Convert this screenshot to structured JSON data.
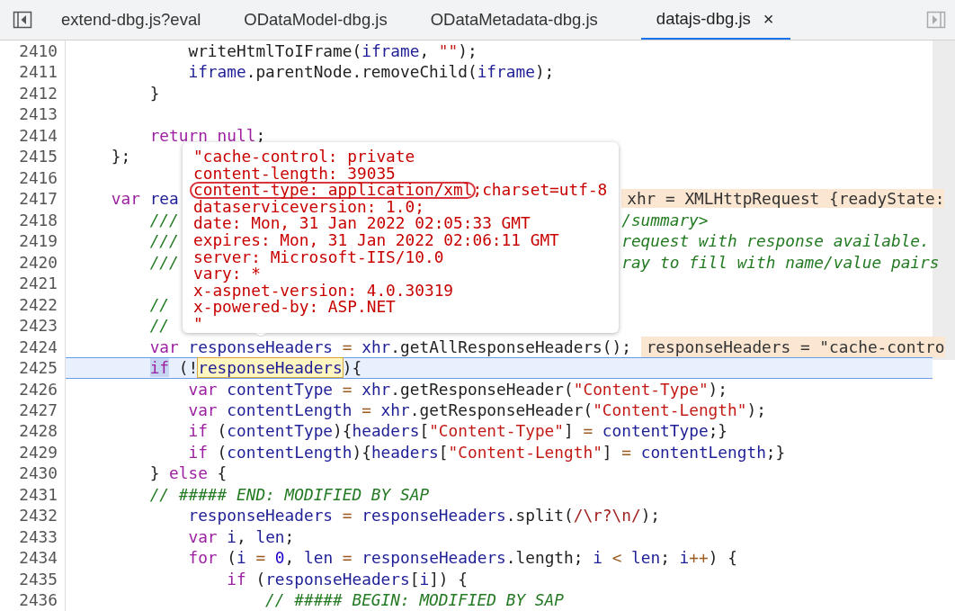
{
  "tabs": [
    {
      "label": "extend-dbg.js?eval",
      "selected": false
    },
    {
      "label": "ODataModel-dbg.js",
      "selected": false
    },
    {
      "label": "ODataMetadata-dbg.js",
      "selected": false
    },
    {
      "label": "datajs-dbg.js",
      "selected": true,
      "close": "×"
    }
  ],
  "lines": [
    {
      "number": "2410",
      "selected": false,
      "tokens": [
        {
          "kind": "plain",
          "text": "            writeHtmlToIFrame("
        },
        {
          "kind": "var",
          "text": "iframe"
        },
        {
          "kind": "plain",
          "text": ", "
        },
        {
          "kind": "str",
          "text": "\"\""
        },
        {
          "kind": "plain",
          "text": ");"
        }
      ]
    },
    {
      "number": "2411",
      "selected": false,
      "tokens": [
        {
          "kind": "var",
          "text": "            iframe"
        },
        {
          "kind": "plain",
          "text": ".parentNode.removeChild("
        },
        {
          "kind": "var",
          "text": "iframe"
        },
        {
          "kind": "plain",
          "text": ");"
        }
      ]
    },
    {
      "number": "2412",
      "selected": false,
      "tokens": [
        {
          "kind": "plain",
          "text": "        }"
        }
      ]
    },
    {
      "number": "2413",
      "selected": false
    },
    {
      "number": "2414",
      "selected": false,
      "tokens": [
        {
          "kind": "kw",
          "text": "        return null"
        },
        {
          "kind": "plain",
          "text": ";"
        }
      ]
    },
    {
      "number": "2415",
      "selected": false,
      "tokens": [
        {
          "kind": "plain",
          "text": "    };"
        }
      ]
    },
    {
      "number": "2416",
      "selected": false
    },
    {
      "number": "2417",
      "selected": false,
      "tokens": [
        {
          "kind": "kw",
          "text": "    var"
        },
        {
          "kind": "var",
          "text": " rea"
        }
      ],
      "aside": [
        {
          "kind": "value",
          "text": "xhr = XMLHttpRequest {readyState:"
        }
      ]
    },
    {
      "number": "2418",
      "selected": false,
      "tokens": [
        {
          "kind": "comment",
          "text": "        ///"
        }
      ],
      "aside": [
        {
          "kind": "comment",
          "text": "/summary>"
        }
      ]
    },
    {
      "number": "2419",
      "selected": false,
      "tokens": [
        {
          "kind": "comment",
          "text": "        ///"
        }
      ],
      "aside": [
        {
          "kind": "comment",
          "text": "request with response available."
        }
      ]
    },
    {
      "number": "2420",
      "selected": false,
      "tokens": [
        {
          "kind": "comment",
          "text": "        ///"
        }
      ],
      "aside": [
        {
          "kind": "comment",
          "text": "ray to fill with name/value pairs"
        }
      ]
    },
    {
      "number": "2421",
      "selected": false
    },
    {
      "number": "2422",
      "selected": false,
      "tokens": [
        {
          "kind": "comment",
          "text": "        //"
        }
      ]
    },
    {
      "number": "2423",
      "selected": false,
      "tokens": [
        {
          "kind": "comment",
          "text": "        //"
        }
      ]
    },
    {
      "number": "2424",
      "selected": false,
      "tokens": [
        {
          "kind": "kw",
          "text": "        var"
        },
        {
          "kind": "var",
          "text": " responseHeaders"
        },
        {
          "kind": "op",
          "text": " = "
        },
        {
          "kind": "var",
          "text": "xhr"
        },
        {
          "kind": "plain",
          "text": ".getAllResponseHeaders();"
        },
        {
          "kind": "value",
          "text": "responseHeaders = \"cache-contro"
        }
      ]
    },
    {
      "number": "2425",
      "selected": true,
      "tokens": [
        {
          "kind": "selection",
          "text": "        if"
        },
        {
          "kind": "plain",
          "text": " (!"
        },
        {
          "kind": "hover",
          "text": "responseHeaders"
        },
        {
          "kind": "plain",
          "text": "){"
        }
      ]
    },
    {
      "number": "2426",
      "selected": false,
      "tokens": [
        {
          "kind": "kw",
          "text": "            var"
        },
        {
          "kind": "var",
          "text": " contentType"
        },
        {
          "kind": "op",
          "text": " = "
        },
        {
          "kind": "var",
          "text": "xhr"
        },
        {
          "kind": "plain",
          "text": ".getResponseHeader("
        },
        {
          "kind": "str",
          "text": "\"Content-Type\""
        },
        {
          "kind": "plain",
          "text": ");"
        }
      ]
    },
    {
      "number": "2427",
      "selected": false,
      "tokens": [
        {
          "kind": "kw",
          "text": "            var"
        },
        {
          "kind": "var",
          "text": " contentLength"
        },
        {
          "kind": "op",
          "text": " = "
        },
        {
          "kind": "var",
          "text": "xhr"
        },
        {
          "kind": "plain",
          "text": ".getResponseHeader("
        },
        {
          "kind": "str",
          "text": "\"Content-Length\""
        },
        {
          "kind": "plain",
          "text": ");"
        }
      ]
    },
    {
      "number": "2428",
      "selected": false,
      "tokens": [
        {
          "kind": "kw",
          "text": "            if"
        },
        {
          "kind": "plain",
          "text": " ("
        },
        {
          "kind": "var",
          "text": "contentType"
        },
        {
          "kind": "plain",
          "text": "){"
        },
        {
          "kind": "var",
          "text": "headers"
        },
        {
          "kind": "plain",
          "text": "["
        },
        {
          "kind": "str",
          "text": "\"Content-Type\""
        },
        {
          "kind": "plain",
          "text": "]"
        },
        {
          "kind": "op",
          "text": " = "
        },
        {
          "kind": "var",
          "text": "contentType"
        },
        {
          "kind": "plain",
          "text": ";}"
        }
      ]
    },
    {
      "number": "2429",
      "selected": false,
      "tokens": [
        {
          "kind": "kw",
          "text": "            if"
        },
        {
          "kind": "plain",
          "text": " ("
        },
        {
          "kind": "var",
          "text": "contentLength"
        },
        {
          "kind": "plain",
          "text": "){"
        },
        {
          "kind": "var",
          "text": "headers"
        },
        {
          "kind": "plain",
          "text": "["
        },
        {
          "kind": "str",
          "text": "\"Content-Length\""
        },
        {
          "kind": "plain",
          "text": "]"
        },
        {
          "kind": "op",
          "text": " = "
        },
        {
          "kind": "var",
          "text": "contentLength"
        },
        {
          "kind": "plain",
          "text": ";}"
        }
      ]
    },
    {
      "number": "2430",
      "selected": false,
      "tokens": [
        {
          "kind": "plain",
          "text": "        } "
        },
        {
          "kind": "kw",
          "text": "else"
        },
        {
          "kind": "plain",
          "text": " {"
        }
      ]
    },
    {
      "number": "2431",
      "selected": false,
      "tokens": [
        {
          "kind": "comment",
          "text": "        // ##### END: MODIFIED BY SAP"
        }
      ]
    },
    {
      "number": "2432",
      "selected": false,
      "tokens": [
        {
          "kind": "var",
          "text": "            responseHeaders"
        },
        {
          "kind": "op",
          "text": " = "
        },
        {
          "kind": "var",
          "text": "responseHeaders"
        },
        {
          "kind": "plain",
          "text": ".split("
        },
        {
          "kind": "regex",
          "text": "/\\r?\\n/"
        },
        {
          "kind": "plain",
          "text": ");"
        }
      ]
    },
    {
      "number": "2433",
      "selected": false,
      "tokens": [
        {
          "kind": "kw",
          "text": "            var"
        },
        {
          "kind": "var",
          "text": " i"
        },
        {
          "kind": "plain",
          "text": ", "
        },
        {
          "kind": "var",
          "text": "len"
        },
        {
          "kind": "plain",
          "text": ";"
        }
      ]
    },
    {
      "number": "2434",
      "selected": false,
      "tokens": [
        {
          "kind": "kw",
          "text": "            for"
        },
        {
          "kind": "plain",
          "text": " ("
        },
        {
          "kind": "var",
          "text": "i"
        },
        {
          "kind": "op",
          "text": " = "
        },
        {
          "kind": "num",
          "text": "0"
        },
        {
          "kind": "plain",
          "text": ", "
        },
        {
          "kind": "var",
          "text": "len"
        },
        {
          "kind": "op",
          "text": " = "
        },
        {
          "kind": "var",
          "text": "responseHeaders"
        },
        {
          "kind": "plain",
          "text": ".length; "
        },
        {
          "kind": "var",
          "text": "i"
        },
        {
          "kind": "op",
          "text": " < "
        },
        {
          "kind": "var",
          "text": "len"
        },
        {
          "kind": "plain",
          "text": "; "
        },
        {
          "kind": "var",
          "text": "i"
        },
        {
          "kind": "op",
          "text": "++"
        },
        {
          "kind": "plain",
          "text": ") {"
        }
      ]
    },
    {
      "number": "2435",
      "selected": false,
      "tokens": [
        {
          "kind": "kw",
          "text": "                if"
        },
        {
          "kind": "plain",
          "text": " ("
        },
        {
          "kind": "var",
          "text": "responseHeaders"
        },
        {
          "kind": "plain",
          "text": "["
        },
        {
          "kind": "var",
          "text": "i"
        },
        {
          "kind": "plain",
          "text": "]) {"
        }
      ]
    },
    {
      "number": "2436",
      "selected": false,
      "tokens": [
        {
          "kind": "comment",
          "text": "                    // ##### BEGIN: MODIFIED BY SAP"
        }
      ]
    }
  ],
  "tooltip": {
    "lines": [
      [
        {
          "text": "\"cache-control: private",
          "circled": false
        }
      ],
      [
        {
          "text": "content-length: 39035",
          "circled": false
        }
      ],
      [
        {
          "text": "content-type: application/xml",
          "circled": true
        },
        {
          "text": ";charset=utf-8",
          "circled": false
        }
      ],
      [
        {
          "text": "dataserviceversion: 1.0;",
          "circled": false
        }
      ],
      [
        {
          "text": "date: Mon, 31 Jan 2022 02:05:33 GMT",
          "circled": false
        }
      ],
      [
        {
          "text": "expires: Mon, 31 Jan 2022 02:06:11 GMT",
          "circled": false
        }
      ],
      [
        {
          "text": "server: Microsoft-IIS/10.0",
          "circled": false
        }
      ],
      [
        {
          "text": "vary: *",
          "circled": false
        }
      ],
      [
        {
          "text": "x-aspnet-version: 4.0.30319",
          "circled": false
        }
      ],
      [
        {
          "text": "x-powered-by: ASP.NET",
          "circled": false
        }
      ],
      [
        {
          "text": "\"",
          "circled": false
        }
      ]
    ]
  }
}
